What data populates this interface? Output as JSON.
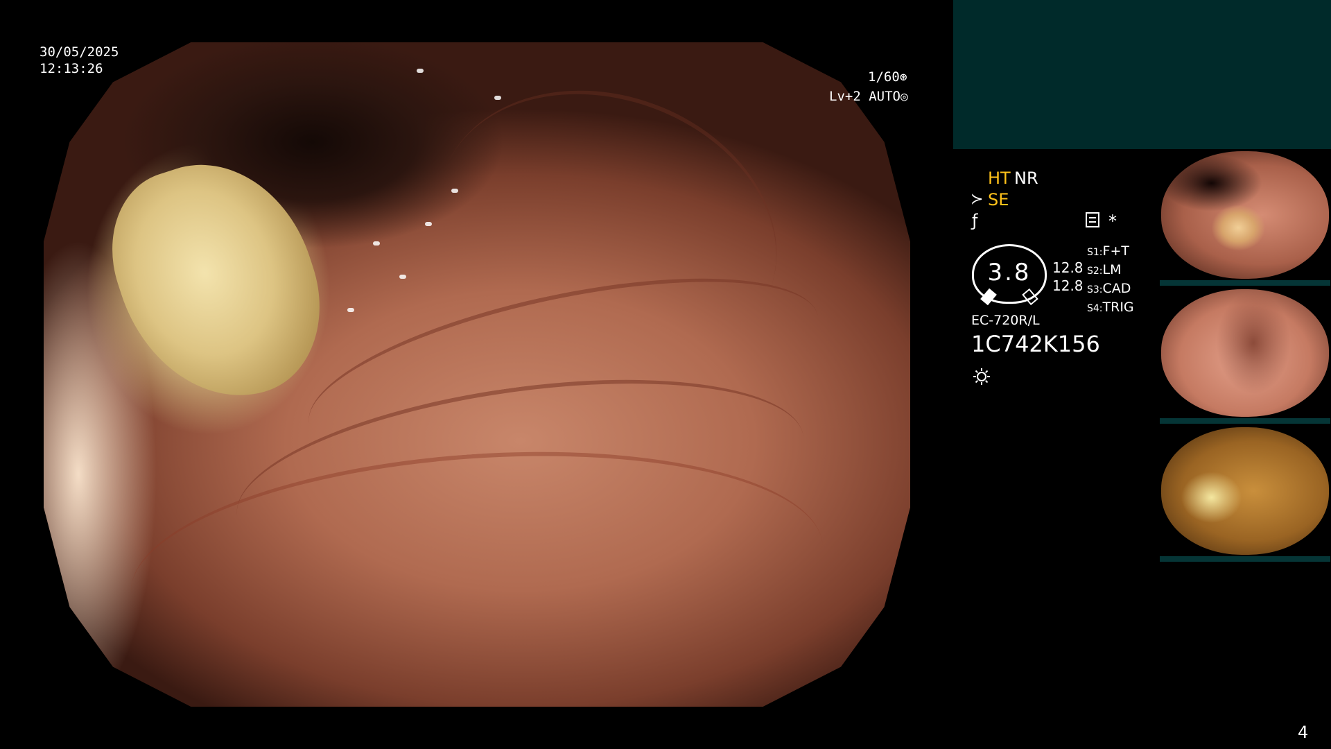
{
  "overlay": {
    "date": "30/05/2025",
    "time": "12:13:26",
    "shutter": "1/60",
    "shutter_icon": "aperture-icon",
    "level": "Lv+2 AUTO",
    "level_icon": "auto-iris-icon"
  },
  "panel": {
    "ht": "HT",
    "nr": "NR",
    "se": "SE",
    "accent_color": "#ffc21a",
    "teal_color": "#002a2a",
    "gauge_value": "3.8",
    "value_1": "12.8",
    "value_2": "12.8",
    "slots": [
      {
        "key": "S1:",
        "value": "F+T"
      },
      {
        "key": "S2:",
        "value": "LM"
      },
      {
        "key": "S3:",
        "value": "CAD"
      },
      {
        "key": "S4:",
        "value": "TRIG"
      }
    ],
    "model": "EC-720R/L",
    "serial": "1C742K156",
    "icons": [
      "scope-icon",
      "freeze-icon",
      "menu-icon",
      "star-icon",
      "light-icon"
    ]
  },
  "thumbnails": [
    "thumbnail-1",
    "thumbnail-2",
    "thumbnail-3"
  ],
  "page_number": "4"
}
